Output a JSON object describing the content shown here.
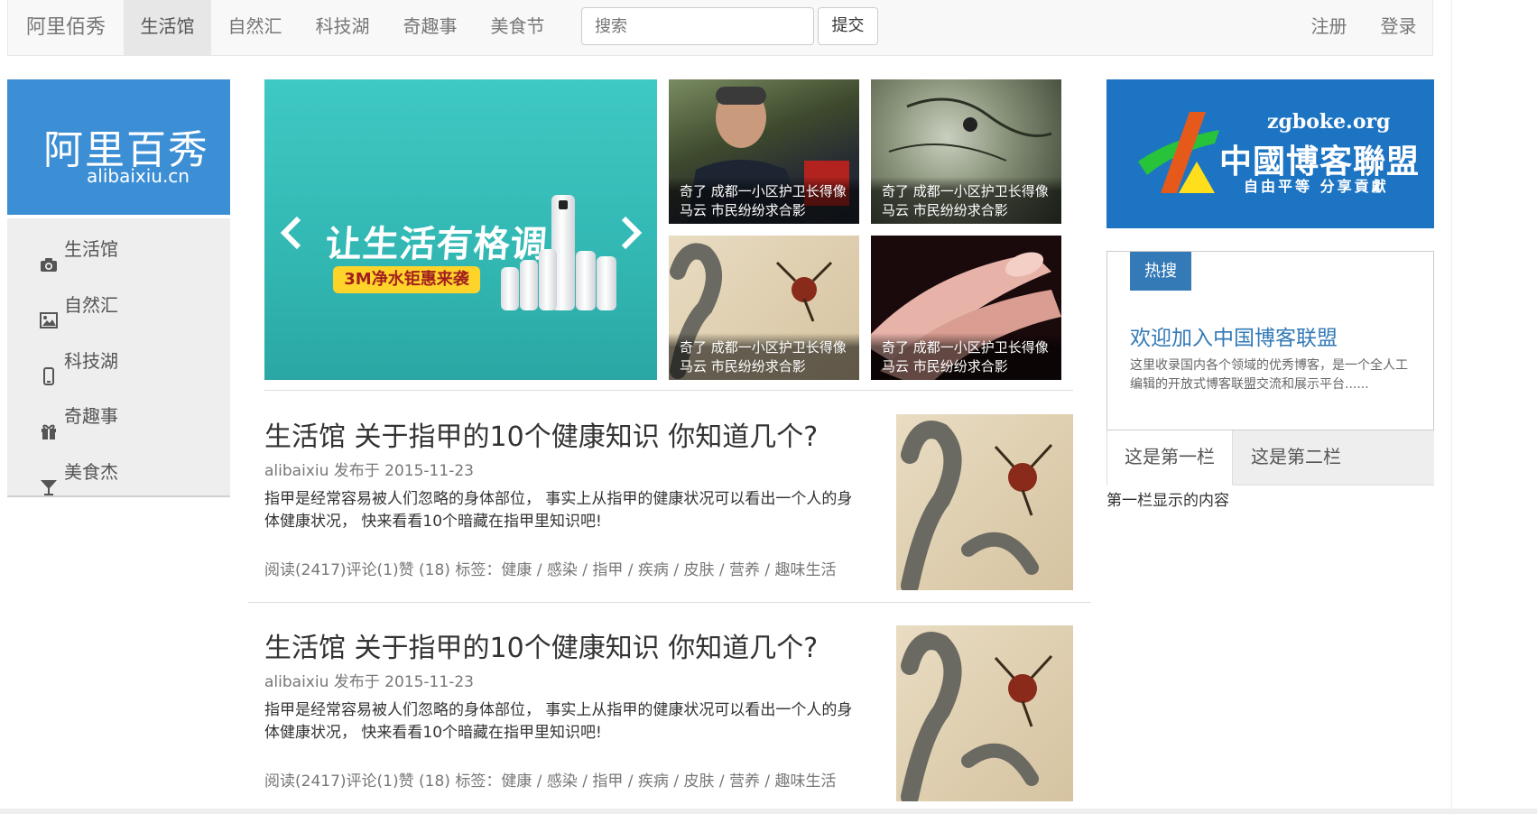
{
  "navbar": {
    "brand": "阿里佰秀",
    "items": [
      "生活馆",
      "自然汇",
      "科技湖",
      "奇趣事",
      "美食节"
    ],
    "active_index": 0,
    "search": {
      "placeholder": "搜索",
      "value": ""
    },
    "submit_label": "提交",
    "register_label": "注册",
    "login_label": "登录"
  },
  "sidebar": {
    "logo_cn": "阿里百秀",
    "logo_en": "alibaixiu.cn",
    "items": [
      {
        "label": "生活馆",
        "icon": "camera-icon"
      },
      {
        "label": "自然汇",
        "icon": "picture-icon"
      },
      {
        "label": "科技湖",
        "icon": "phone-icon"
      },
      {
        "label": "奇趣事",
        "icon": "gift-icon"
      },
      {
        "label": "美食杰",
        "icon": "glass-icon"
      }
    ]
  },
  "slider": {
    "headline": "让生活有格调",
    "subline": "3M净水钜惠来袭",
    "prev_icon": "chevron-left-icon",
    "next_icon": "chevron-right-icon"
  },
  "thumbs": [
    {
      "caption_line1": "奇了 成都一小区护卫长得像",
      "caption_line2": "马云 市民纷纷求合影"
    },
    {
      "caption_line1": "奇了 成都一小区护卫长得像",
      "caption_line2": "马云 市民纷纷求合影"
    },
    {
      "caption_line1": "奇了 成都一小区护卫长得像",
      "caption_line2": "马云 市民纷纷求合影"
    },
    {
      "caption_line1": "奇了 成都一小区护卫长得像",
      "caption_line2": "马云 市民纷纷求合影"
    }
  ],
  "articles": [
    {
      "title": "生活馆 关于指甲的10个健康知识 你知道几个?",
      "meta": "alibaixiu 发布于 2015-11-23",
      "body": "指甲是经常容易被人们忽略的身体部位， 事实上从指甲的健康状况可以看出一个人的身体健康状况， 快来看看10个暗藏在指甲里知识吧!",
      "footer": "阅读(2417)评论(1)赞 (18) 标签：健康 / 感染 / 指甲 / 疾病 / 皮肤 / 营养 / 趣味生活"
    },
    {
      "title": "生活馆 关于指甲的10个健康知识 你知道几个?",
      "meta": "alibaixiu 发布于 2015-11-23",
      "body": "指甲是经常容易被人们忽略的身体部位， 事实上从指甲的健康状况可以看出一个人的身体健康状况， 快来看看10个暗藏在指甲里知识吧!",
      "footer": "阅读(2417)评论(1)赞 (18) 标签：健康 / 感染 / 指甲 / 疾病 / 皮肤 / 营养 / 趣味生活"
    }
  ],
  "right": {
    "banner": {
      "url": "zgboke.org",
      "name": "中國博客聯盟",
      "slogan": "自由平等  分享貢獻"
    },
    "hot": {
      "badge": "热搜",
      "title": "欢迎加入中国博客联盟",
      "desc": "这里收录国内各个领域的优秀博客，是一个全人工编辑的开放式博客联盟交流和展示平台......"
    },
    "tabs": [
      "这是第一栏",
      "这是第二栏"
    ],
    "active_tab": 0,
    "tab_content": "第一栏显示的内容"
  },
  "colors": {
    "primary": "#337ab7",
    "logo_bg": "#3d8fd5",
    "banner_bg": "#1d74c3",
    "slider_bg": "#3fc9c4"
  }
}
